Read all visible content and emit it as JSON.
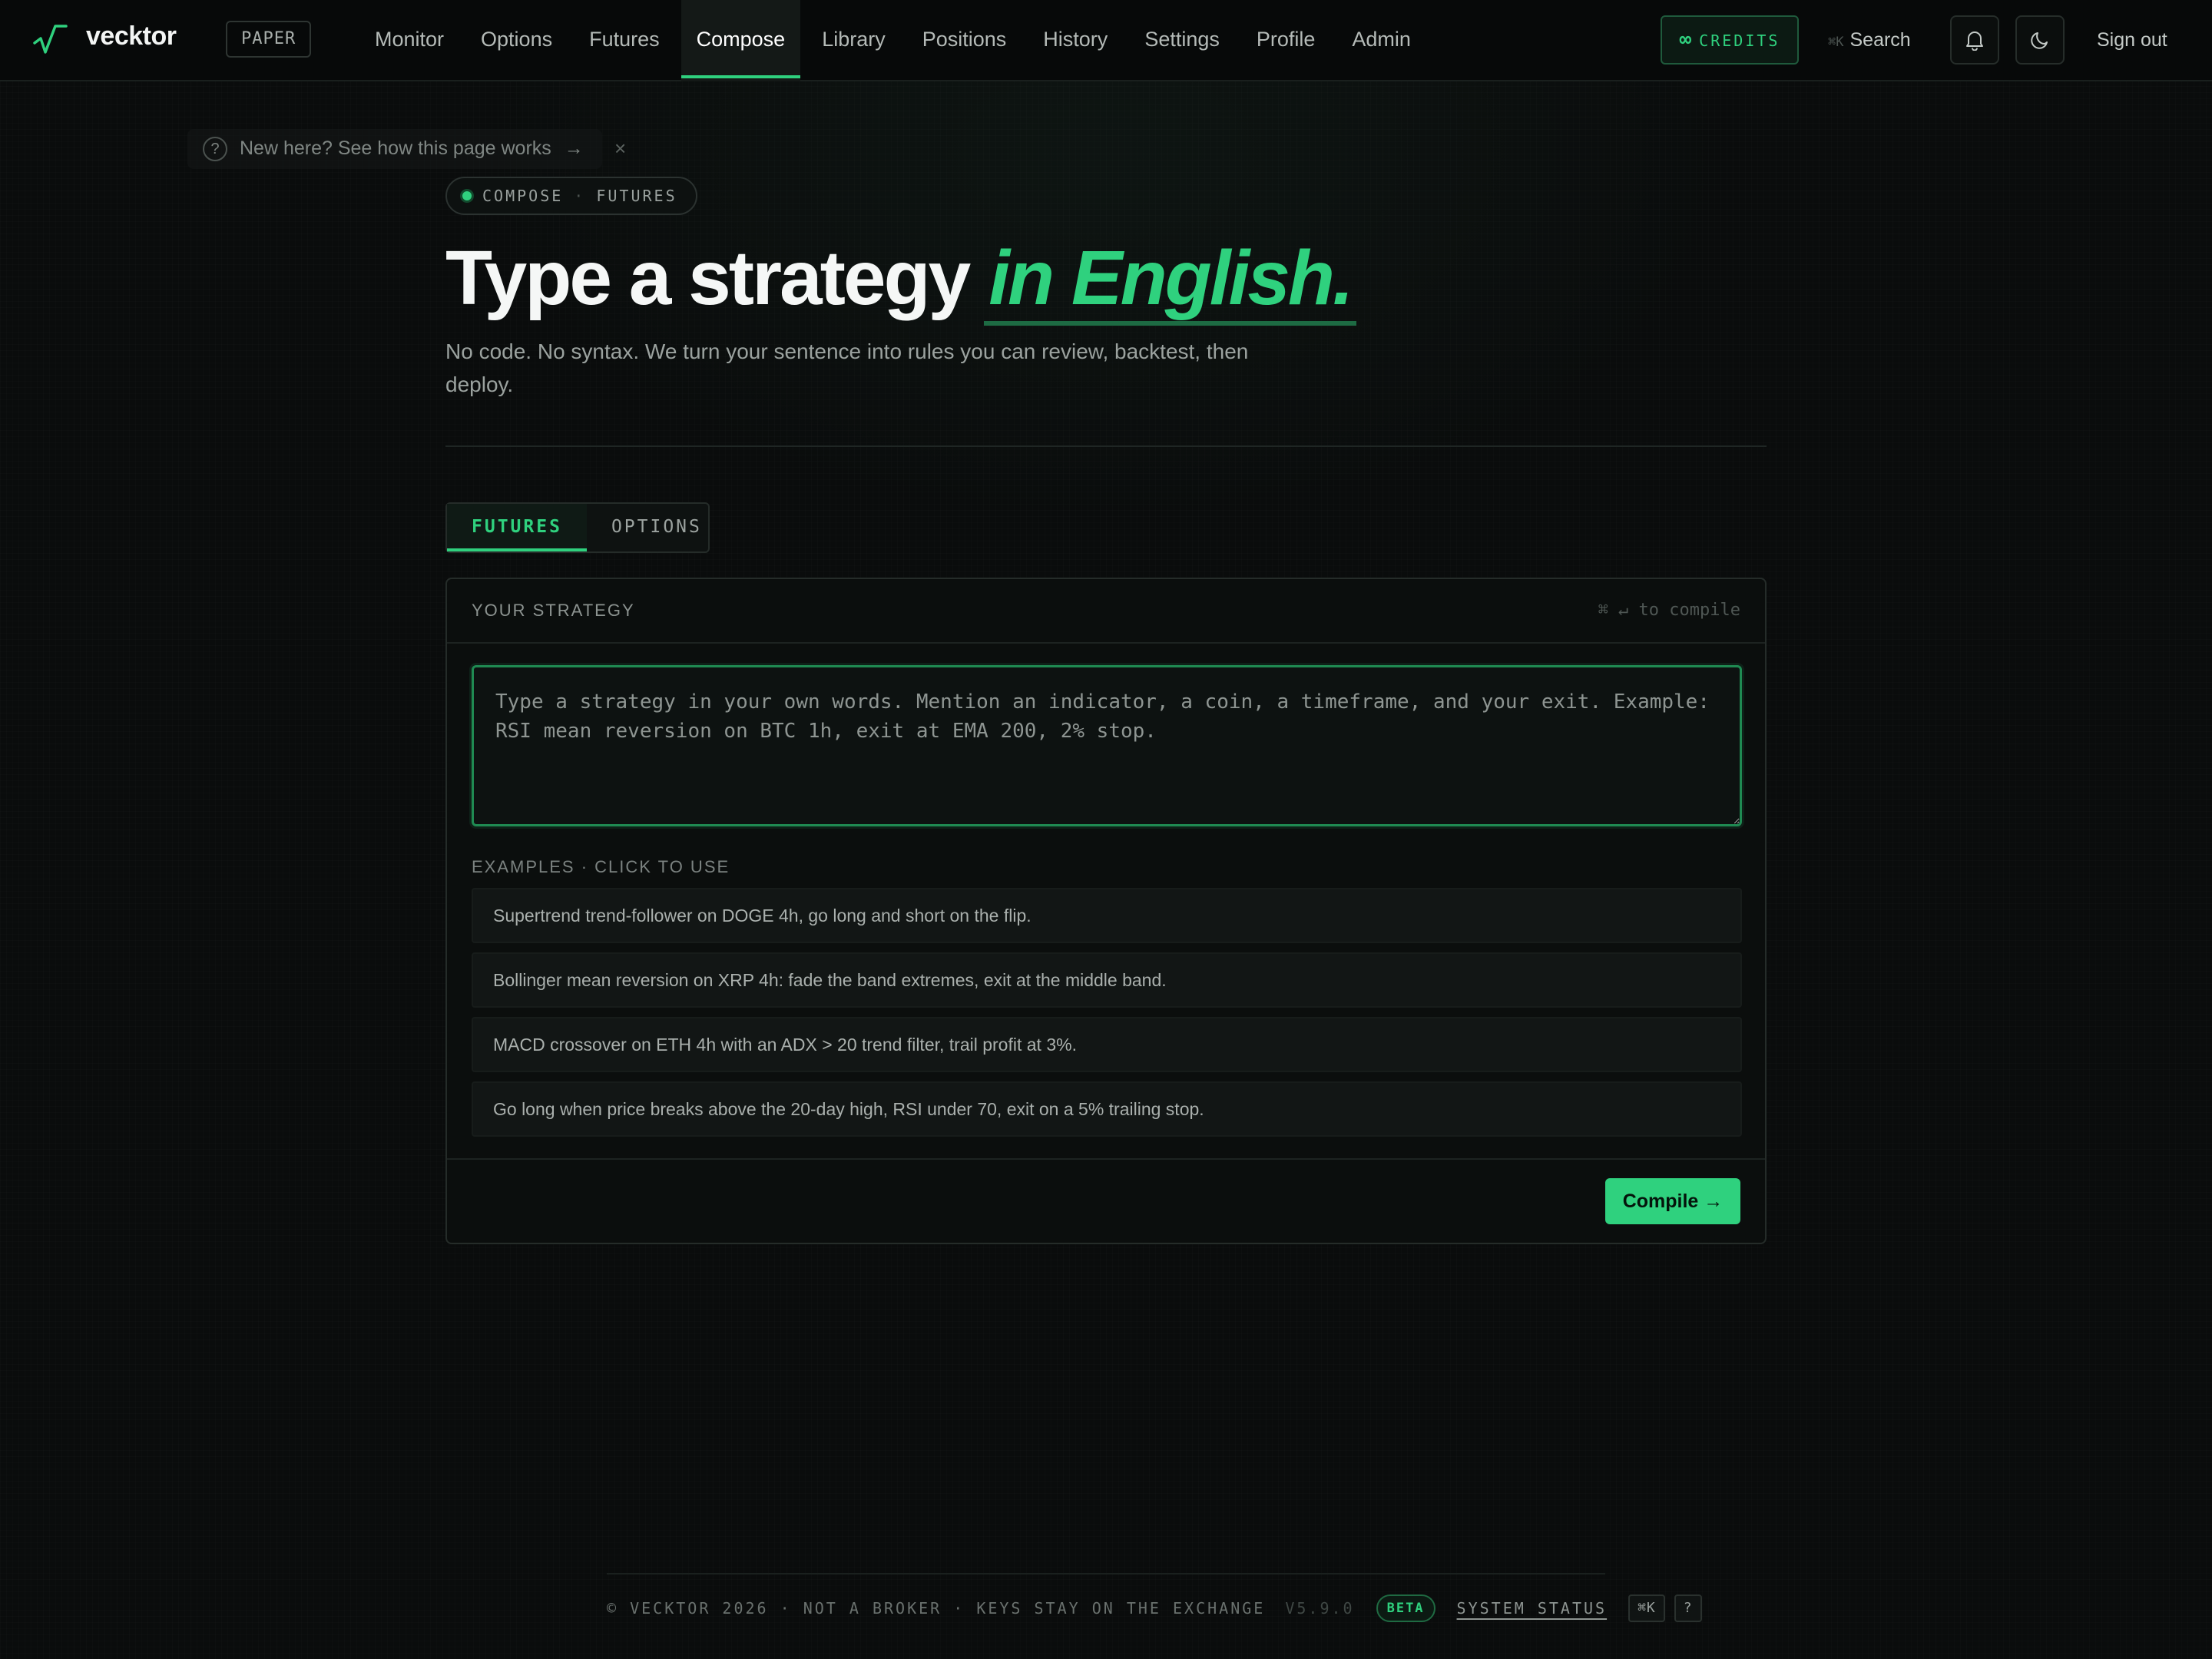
{
  "app": {
    "brand": "vecktor",
    "mode_badge": "PAPER"
  },
  "nav": {
    "items": [
      {
        "label": "Monitor",
        "active": false
      },
      {
        "label": "Options",
        "active": false
      },
      {
        "label": "Futures",
        "active": false
      },
      {
        "label": "Compose",
        "active": true
      },
      {
        "label": "Library",
        "active": false
      },
      {
        "label": "Positions",
        "active": false
      },
      {
        "label": "History",
        "active": false
      },
      {
        "label": "Settings",
        "active": false
      },
      {
        "label": "Profile",
        "active": false
      },
      {
        "label": "Admin",
        "active": false
      }
    ],
    "credits_label": "CREDITS",
    "credits_symbol": "∞",
    "search_shortcut": "⌘K",
    "search_label": "Search",
    "sign_out": "Sign out"
  },
  "onboarding": {
    "text": "New here? See how this page works",
    "arrow": "→",
    "close": "×"
  },
  "header": {
    "crumb_section": "COMPOSE",
    "crumb_separator": "·",
    "crumb_page": "FUTURES",
    "title_plain": "Type a strategy",
    "title_accent": "in English.",
    "subtitle": "No code. No syntax. We turn your sentence into rules you can review, backtest, then deploy."
  },
  "tabs": [
    {
      "label": "FUTURES",
      "active": true
    },
    {
      "label": "OPTIONS",
      "active": false
    }
  ],
  "strategy": {
    "title": "YOUR STRATEGY",
    "shortcut_hint": "⌘ ↵ to compile",
    "input_value": "",
    "placeholder": "Type a strategy in your own words. Mention an indicator, a coin, a timeframe, and your exit. Example: RSI mean reversion on BTC 1h, exit at EMA 200, 2% stop.",
    "examples_label": "EXAMPLES · CLICK TO USE",
    "examples": [
      "Supertrend trend-follower on DOGE 4h, go long and short on the flip.",
      "Bollinger mean reversion on XRP 4h: fade the band extremes, exit at the middle band.",
      "MACD crossover on ETH 4h with an ADX > 20 trend filter, trail profit at 3%.",
      "Go long when price breaks above the 20-day high, RSI under 70, exit on a 5% trailing stop."
    ],
    "compile_label": "Compile →"
  },
  "footer": {
    "text": "© VECKTOR 2026 · NOT A BROKER · KEYS STAY ON THE EXCHANGE",
    "version": "V5.9.0",
    "badge": "BETA",
    "status_link": "SYSTEM STATUS",
    "shortcut": "⌘K",
    "help": "?"
  },
  "colors": {
    "accent": "#2fd17e",
    "background": "#0a0c0c",
    "panel": "#0b0e0d",
    "text": "#e6e8e7",
    "muted": "#9ba29f"
  },
  "icons": [
    "vecktor-logo-icon",
    "bell-icon",
    "moon-icon",
    "help-circle-icon",
    "close-icon"
  ]
}
